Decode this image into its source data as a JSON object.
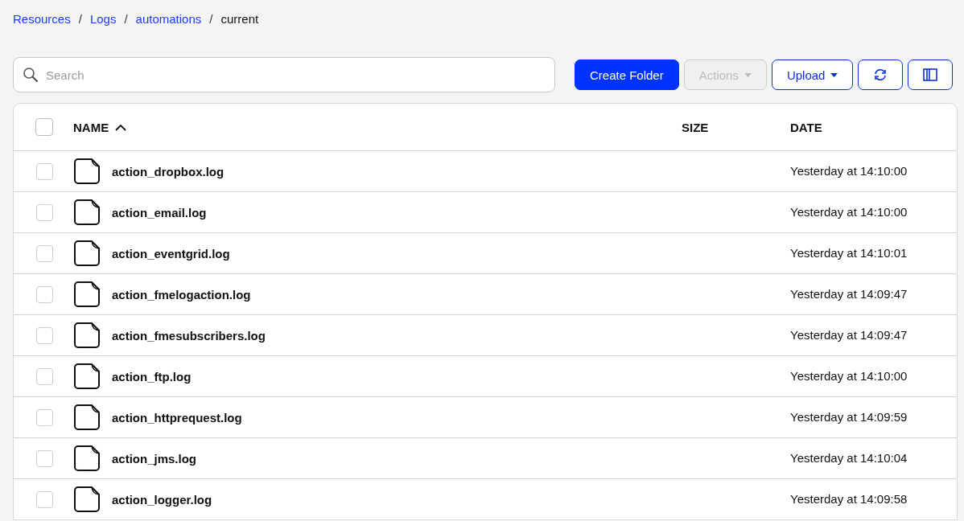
{
  "breadcrumb": [
    {
      "label": "Resources",
      "link": true
    },
    {
      "label": "Logs",
      "link": true
    },
    {
      "label": "automations",
      "link": true
    },
    {
      "label": "current",
      "link": false
    }
  ],
  "breadcrumb_separators": [
    "/",
    "/",
    "/"
  ],
  "search": {
    "placeholder": "Search"
  },
  "toolbar": [
    {
      "kind": "primary",
      "label": "Create Folder",
      "disabled": false
    },
    {
      "kind": "dropdown",
      "label": "Actions",
      "disabled": true
    },
    {
      "kind": "dropdown",
      "label": "Upload",
      "disabled": false
    },
    {
      "kind": "refresh",
      "disabled": false
    },
    {
      "kind": "columns",
      "disabled": false
    }
  ],
  "table": {
    "select_all_checked": false,
    "columns": [
      {
        "label": "NAME",
        "sorted": true
      },
      {
        "label": "SIZE",
        "sorted": false
      },
      {
        "label": "DATE",
        "sorted": false
      }
    ],
    "rows": [
      {
        "name": "action_dropbox.log",
        "date": "Yesterday at 14:10:00",
        "checked": false
      },
      {
        "name": "action_email.log",
        "date": "Yesterday at 14:10:00",
        "checked": false
      },
      {
        "name": "action_eventgrid.log",
        "date": "Yesterday at 14:10:01",
        "checked": false
      },
      {
        "name": "action_fmelogaction.log",
        "date": "Yesterday at 14:09:47",
        "checked": false
      },
      {
        "name": "action_fmesubscribers.log",
        "date": "Yesterday at 14:09:47",
        "checked": false
      },
      {
        "name": "action_ftp.log",
        "date": "Yesterday at 14:10:00",
        "checked": false
      },
      {
        "name": "action_httprequest.log",
        "date": "Yesterday at 14:09:59",
        "checked": false
      },
      {
        "name": "action_jms.log",
        "date": "Yesterday at 14:10:04",
        "checked": false
      },
      {
        "name": "action_logger.log",
        "date": "Yesterday at 14:09:58",
        "checked": false
      }
    ]
  }
}
